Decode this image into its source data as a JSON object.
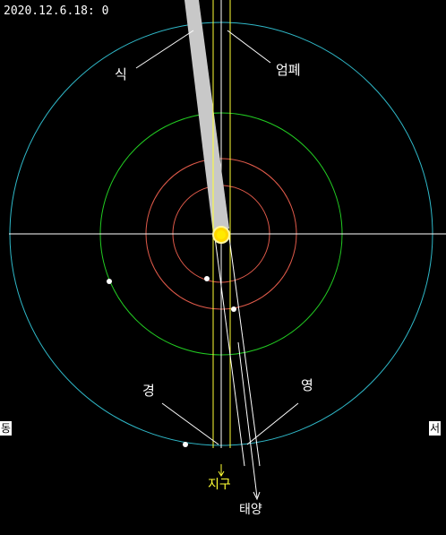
{
  "header": {
    "datetime": "2020.12.6.18: 0"
  },
  "directions": {
    "east": "동",
    "west": "서"
  },
  "labels": {
    "eclipse": "식",
    "occultation": "엄폐",
    "transit": "경",
    "shadow_transit": "영",
    "earth": "지구",
    "sun": "태양"
  },
  "colors": {
    "background": "#000000",
    "orbit_outer": "#2fb8c8",
    "orbit_middle": "#22cc22",
    "orbit_inner": "#e05a4a",
    "axis_lines": "#ffffff",
    "earth_direction": "#ffff33",
    "shadow": "#c8c8c8",
    "planet": "#ffd700"
  }
}
